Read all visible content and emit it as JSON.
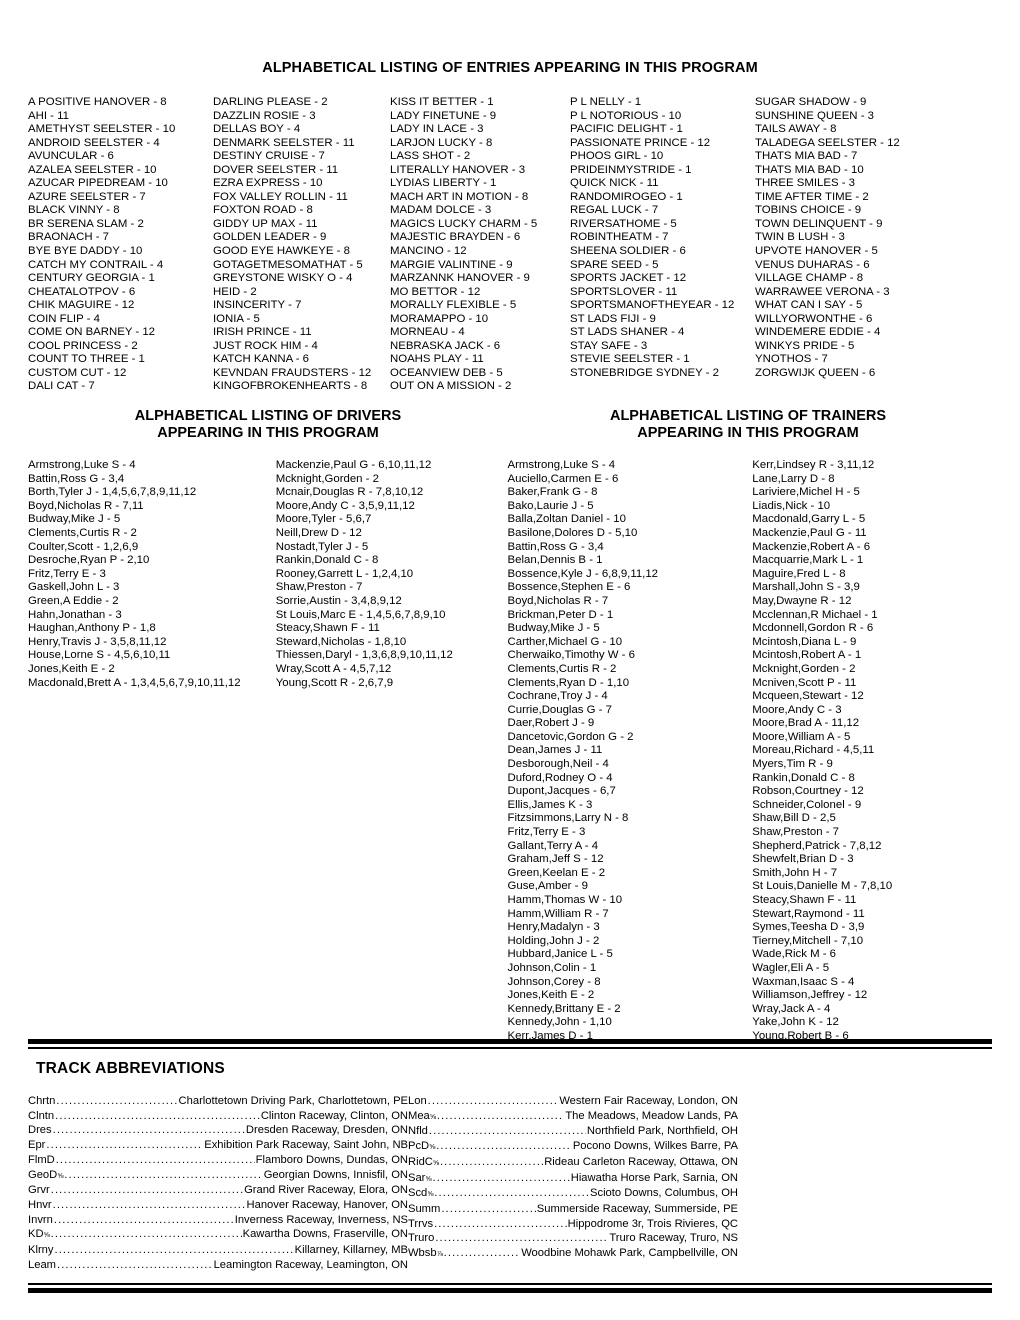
{
  "entries": {
    "title": "ALPHABETICAL LISTING OF ENTRIES APPEARING IN THIS PROGRAM",
    "columns": [
      [
        "A POSITIVE HANOVER - 8",
        "AHI - 11",
        "AMETHYST SEELSTER - 10",
        "ANDROID SEELSTER - 4",
        "AVUNCULAR - 6",
        "AZALEA SEELSTER - 10",
        "AZUCAR PIPEDREAM - 10",
        "AZURE SEELSTER - 7",
        "BLACK VINNY - 8",
        "BR SERENA SLAM - 2",
        "BRAONACH - 7",
        "BYE BYE DADDY - 10",
        "CATCH MY CONTRAIL - 4",
        "CENTURY GEORGIA - 1",
        "CHEATALOTPOV - 6",
        "CHIK MAGUIRE - 12",
        "COIN FLIP - 4",
        "COME ON BARNEY - 12",
        "COOL PRINCESS - 2",
        "COUNT TO THREE - 1",
        "CUSTOM CUT - 12",
        "DALI CAT - 7"
      ],
      [
        "DARLING PLEASE - 2",
        "DAZZLIN ROSIE - 3",
        "DELLAS BOY - 4",
        "DENMARK SEELSTER - 11",
        "DESTINY CRUISE - 7",
        "DOVER SEELSTER - 11",
        "EZRA EXPRESS - 10",
        "FOX VALLEY ROLLIN - 11",
        "FOXTON ROAD - 8",
        "GIDDY UP MAX - 11",
        "GOLDEN LEADER - 9",
        "GOOD EYE HAWKEYE - 8",
        "GOTAGETMESOMATHAT - 5",
        "GREYSTONE WISKY O - 4",
        "HEID - 2",
        "INSINCERITY - 7",
        "IONIA - 5",
        "IRISH PRINCE - 11",
        "JUST ROCK HIM - 4",
        "KATCH KANNA - 6",
        "KEVNDAN FRAUDSTERS - 12",
        "KINGOFBROKENHEARTS - 8"
      ],
      [
        "KISS IT BETTER - 1",
        "LADY FINETUNE - 9",
        "LADY IN LACE - 3",
        "LARJON LUCKY - 8",
        "LASS SHOT - 2",
        "LITERALLY HANOVER - 3",
        "LYDIAS LIBERTY - 1",
        "MACH ART IN MOTION - 8",
        "MADAM DOLCE - 3",
        "MAGICS LUCKY CHARM - 5",
        "MAJESTIC BRAYDEN - 6",
        "MANCINO - 12",
        "MARGIE VALINTINE - 9",
        "MARZANNK HANOVER - 9",
        "MO BETTOR - 12",
        "MORALLY FLEXIBLE - 5",
        "MORAMAPPO - 10",
        "MORNEAU - 4",
        "NEBRASKA JACK - 6",
        "NOAHS PLAY - 11",
        "OCEANVIEW DEB - 5",
        "OUT ON A MISSION - 2"
      ],
      [
        "P L NELLY - 1",
        "P L NOTORIOUS - 10",
        "PACIFIC DELIGHT - 1",
        "PASSIONATE PRINCE - 12",
        "PHOOS GIRL - 10",
        "PRIDEINMYSTRIDE - 1",
        "QUICK NICK - 11",
        "RANDOMIROGEO - 1",
        "REGAL LUCK - 7",
        "RIVERSATHOME - 5",
        "ROBINTHEATM - 7",
        "SHEENA SOLDIER - 6",
        "SPARE SEED - 5",
        "SPORTS JACKET - 12",
        "SPORTSLOVER - 11",
        "SPORTSMANOFTHEYEAR - 12",
        "ST LADS FIJI - 9",
        "ST LADS SHANER - 4",
        "STAY SAFE - 3",
        "STEVIE SEELSTER - 1",
        "STONEBRIDGE SYDNEY - 2"
      ],
      [
        "SUGAR SHADOW - 9",
        "SUNSHINE QUEEN - 3",
        "TAILS AWAY - 8",
        "TALADEGA SEELSTER - 12",
        "THATS MIA BAD - 7",
        "THATS MIA BAD - 10",
        "THREE SMILES - 3",
        "TIME AFTER TIME - 2",
        "TOBINS CHOICE - 9",
        "TOWN DELINQUENT - 9",
        "TWIN B LUSH - 3",
        "UPVOTE HANOVER - 5",
        "VENUS DUHARAS - 6",
        "VILLAGE CHAMP - 8",
        "WARRAWEE VERONA - 3",
        "WHAT CAN I SAY - 5",
        "WILLYORWONTHE - 6",
        "WINDEMERE EDDIE - 4",
        "WINKYS PRIDE - 5",
        "YNOTHOS - 7",
        "ZORGWIJK QUEEN - 6"
      ]
    ]
  },
  "drivers": {
    "title_line1": "ALPHABETICAL LISTING OF DRIVERS",
    "title_line2": "APPEARING IN THIS PROGRAM",
    "columns": [
      [
        "Armstrong,Luke S - 4",
        "Battin,Ross G - 3,4",
        "Borth,Tyler J - 1,4,5,6,7,8,9,11,12",
        "Boyd,Nicholas R - 7,11",
        "Budway,Mike J - 5",
        "Clements,Curtis R - 2",
        "Coulter,Scott - 1,2,6,9",
        "Desroche,Ryan P - 2,10",
        "Fritz,Terry E - 3",
        "Gaskell,John L - 3",
        "Green,A Eddie - 2",
        "Hahn,Jonathan - 3",
        "Haughan,Anthony P - 1,8",
        "Henry,Travis J - 3,5,8,11,12",
        "House,Lorne S - 4,5,6,10,11",
        "Jones,Keith E - 2",
        "Macdonald,Brett A - 1,3,4,5,6,7,9,10,11,12"
      ],
      [
        "Mackenzie,Paul G - 6,10,11,12",
        "Mcknight,Gorden - 2",
        "Mcnair,Douglas R - 7,8,10,12",
        "Moore,Andy C - 3,5,9,11,12",
        "Moore,Tyler - 5,6,7",
        "Neill,Drew D - 12",
        "Nostadt,Tyler J - 5",
        "Rankin,Donald C - 8",
        "Rooney,Garrett L - 1,2,4,10",
        "Shaw,Preston - 7",
        "Sorrie,Austin - 3,4,8,9,12",
        "St Louis,Marc E - 1,4,5,6,7,8,9,10",
        "Steacy,Shawn F - 11",
        "Steward,Nicholas - 1,8,10",
        "Thiessen,Daryl - 1,3,6,8,9,10,11,12",
        "Wray,Scott A - 4,5,7,12",
        "Young,Scott R - 2,6,7,9"
      ]
    ]
  },
  "trainers": {
    "title_line1": "ALPHABETICAL LISTING OF TRAINERS",
    "title_line2": "APPEARING IN THIS PROGRAM",
    "columns": [
      [
        "Armstrong,Luke S - 4",
        "Auciello,Carmen E - 6",
        "Baker,Frank G - 8",
        "Bako,Laurie J - 5",
        "Balla,Zoltan Daniel - 10",
        "Basilone,Dolores D - 5,10",
        "Battin,Ross G - 3,4",
        "Belan,Dennis B - 1",
        "Bossence,Kyle J - 6,8,9,11,12",
        "Bossence,Stephen E - 6",
        "Boyd,Nicholas R - 7",
        "Brickman,Peter D - 1",
        "Budway,Mike J - 5",
        "Carther,Michael G - 10",
        "Cherwaiko,Timothy W - 6",
        "Clements,Curtis R - 2",
        "Clements,Ryan D - 1,10",
        "Cochrane,Troy J - 4",
        "Currie,Douglas G - 7",
        "Daer,Robert J - 9",
        "Dancetovic,Gordon G - 2",
        "Dean,James J - 11",
        "Desborough,Neil - 4",
        "Duford,Rodney O - 4",
        "Dupont,Jacques - 6,7",
        "Ellis,James K - 3",
        "Fitzsimmons,Larry N - 8",
        "Fritz,Terry E - 3",
        "Gallant,Terry A - 4",
        "Graham,Jeff S - 12",
        "Green,Keelan E - 2",
        "Guse,Amber - 9",
        "Hamm,Thomas W - 10",
        "Hamm,William R - 7",
        "Henry,Madalyn - 3",
        "Holding,John J - 2",
        "Hubbard,Janice L - 5",
        "Johnson,Colin - 1",
        "Johnson,Corey - 8",
        "Jones,Keith E - 2",
        "Kennedy,Brittany E - 2",
        "Kennedy,John - 1,10",
        "Kerr,James D - 1"
      ],
      [
        "Kerr,Lindsey R - 3,11,12",
        "Lane,Larry D - 8",
        "Lariviere,Michel H - 5",
        "Liadis,Nick - 10",
        "Macdonald,Garry L - 5",
        "Mackenzie,Paul G - 11",
        "Mackenzie,Robert A - 6",
        "Macquarrie,Mark L - 1",
        "Maguire,Fred L - 8",
        "Marshall,John S - 3,9",
        "May,Dwayne R - 12",
        "Mcclennan,R Michael - 1",
        "Mcdonnell,Gordon R - 6",
        "Mcintosh,Diana L - 9",
        "Mcintosh,Robert A - 1",
        "Mcknight,Gorden - 2",
        "Mcniven,Scott P - 11",
        "Mcqueen,Stewart - 12",
        "Moore,Andy C - 3",
        "Moore,Brad A - 11,12",
        "Moore,William A - 5",
        "Moreau,Richard - 4,5,11",
        "Myers,Tim R - 9",
        "Rankin,Donald C - 8",
        "Robson,Courtney - 12",
        "Schneider,Colonel - 9",
        "Shaw,Bill D - 2,5",
        "Shaw,Preston - 7",
        "Shepherd,Patrick - 7,8,12",
        "Shewfelt,Brian D - 3",
        "Smith,John H - 7",
        "St Louis,Danielle M - 7,8,10",
        "Steacy,Shawn F - 11",
        "Stewart,Raymond - 11",
        "Symes,Teesha D - 3,9",
        "Tierney,Mitchell - 7,10",
        "Wade,Rick M - 6",
        "Wagler,Eli A - 5",
        "Waxman,Isaac S - 4",
        "Williamson,Jeffrey - 12",
        "Wray,Jack A - 4",
        "Yake,John K - 12",
        "Young,Robert B - 6"
      ]
    ]
  },
  "tracks": {
    "title": "TRACK ABBREVIATIONS",
    "left": [
      {
        "abbr": "Chrtn",
        "sup": "",
        "name": "Charlottetown Driving Park, Charlottetown, PE"
      },
      {
        "abbr": "Clntn",
        "sup": "",
        "name": "Clinton Raceway, Clinton, ON"
      },
      {
        "abbr": "Dres",
        "sup": "",
        "name": "Dresden Raceway, Dresden, ON"
      },
      {
        "abbr": "Epr",
        "sup": "",
        "name": "Exhibition Park Raceway, Saint John, NB"
      },
      {
        "abbr": "FlmD",
        "sup": "",
        "name": "Flamboro Downs, Dundas, ON"
      },
      {
        "abbr": "GeoD",
        "sup": "5/8",
        "name": "Georgian Downs, Innisfil, ON"
      },
      {
        "abbr": "Grvr",
        "sup": "",
        "name": "Grand River Raceway, Elora, ON"
      },
      {
        "abbr": "Hnvr",
        "sup": "",
        "name": "Hanover Raceway, Hanover, ON"
      },
      {
        "abbr": "Invrn",
        "sup": "",
        "name": "Inverness Raceway, Inverness, NS"
      },
      {
        "abbr": "KD",
        "sup": "5/8",
        "name": "Kawartha Downs, Fraserville, ON"
      },
      {
        "abbr": "Klrny",
        "sup": "",
        "name": "Killarney, Killarney, MB"
      },
      {
        "abbr": "Leam",
        "sup": "",
        "name": "Leamington Raceway, Leamington, ON"
      }
    ],
    "right": [
      {
        "abbr": "Lon",
        "sup": "",
        "name": "Western Fair Raceway, London, ON"
      },
      {
        "abbr": "Mea",
        "sup": "5/8",
        "name": "The Meadows, Meadow Lands, PA"
      },
      {
        "abbr": "Nfld",
        "sup": "",
        "name": "Northfield Park, Northfield, OH"
      },
      {
        "abbr": "PcD",
        "sup": "5/8",
        "name": "Pocono Downs, Wilkes Barre, PA"
      },
      {
        "abbr": "RidC",
        "sup": "5/8",
        "name": "Rideau Carleton Raceway, Ottawa, ON"
      },
      {
        "abbr": "Sar",
        "sup": "5/8",
        "name": "Hiawatha Horse Park, Sarnia, ON"
      },
      {
        "abbr": "Scd",
        "sup": "5/8",
        "name": "Scioto Downs, Columbus, OH"
      },
      {
        "abbr": "Summ",
        "sup": "",
        "name": "Summerside Raceway, Summerside, PE"
      },
      {
        "abbr": "Trrvs",
        "sup": "",
        "name": "Hippodrome 3r, Trois Rivieres, QC"
      },
      {
        "abbr": "Truro",
        "sup": "",
        "name": "Truro Raceway, Truro, NS"
      },
      {
        "abbr": "Wbsb",
        "sup": "7/8",
        "name": "Woodbine Mohawk Park, Campbellville, ON"
      }
    ]
  }
}
